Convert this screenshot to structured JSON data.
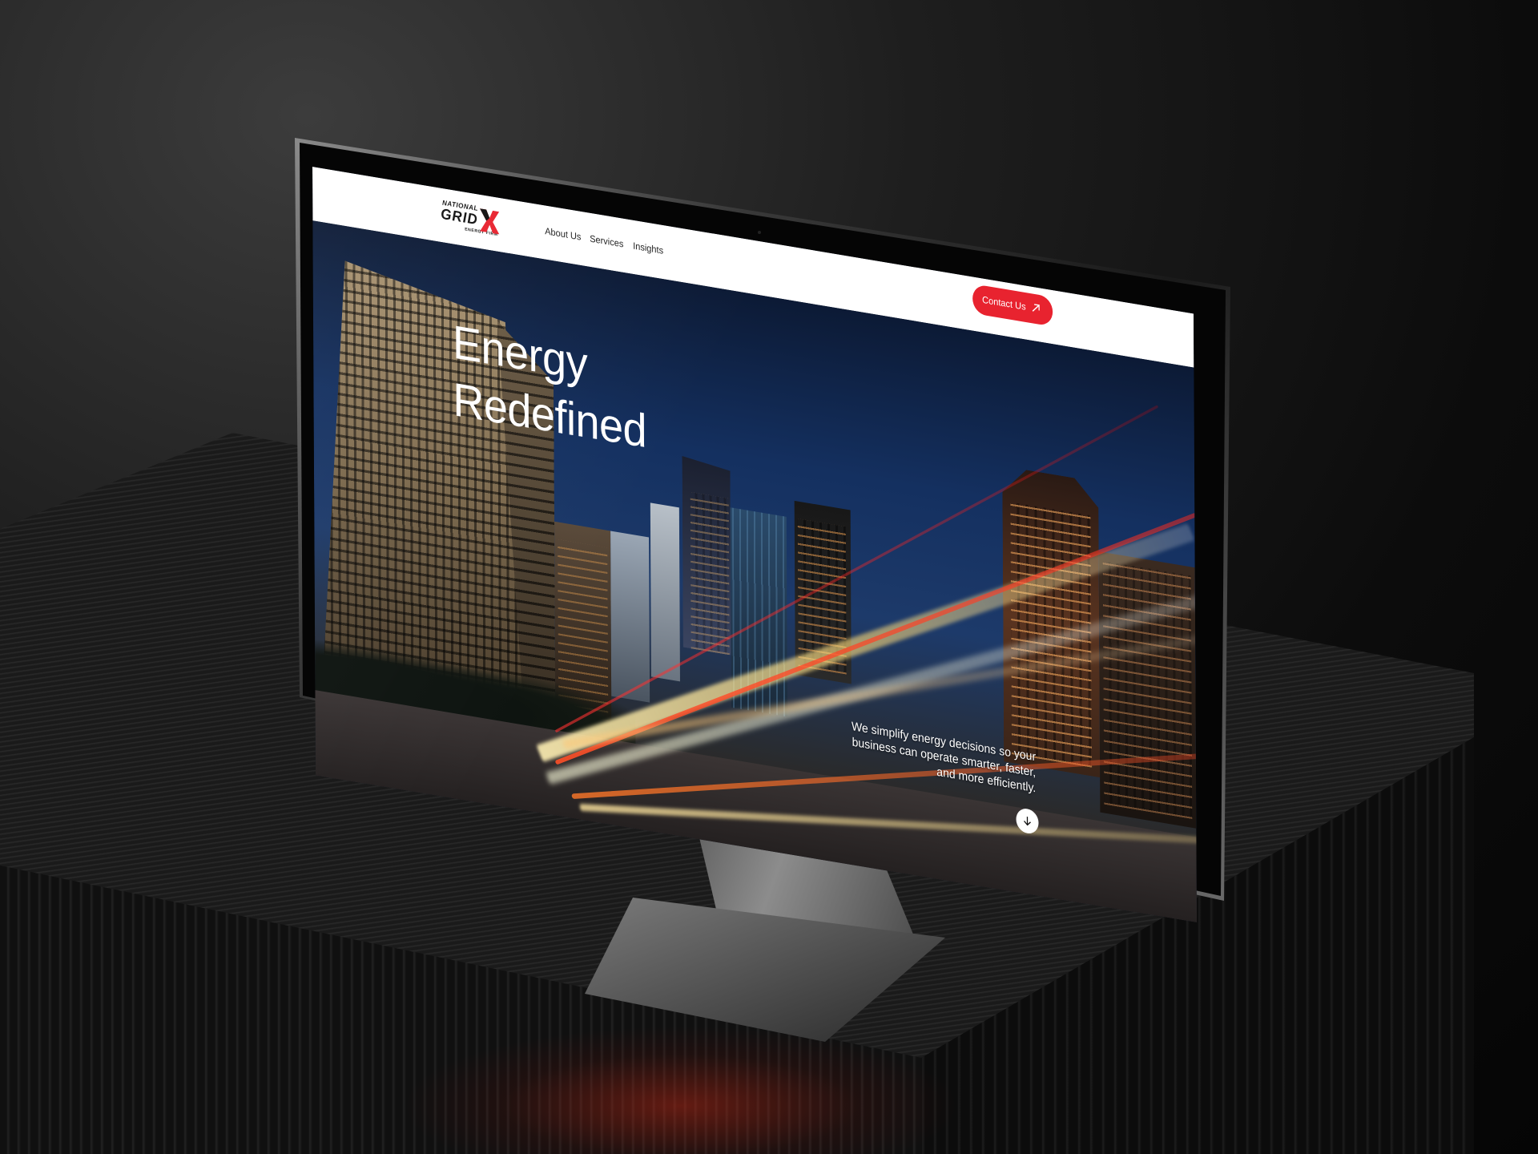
{
  "site": {
    "logo": {
      "line1": "NATIONAL",
      "line2": "GRID",
      "line3": "ENERGY FIRM",
      "mark_icon": "x-mark-icon",
      "brand_color": "#e8232f"
    },
    "nav": {
      "about": "About Us",
      "services": "Services",
      "insights": "Insights"
    },
    "contact_button": {
      "label": "Contact Us",
      "icon": "arrow-up-right-icon",
      "color": "#e8232f"
    },
    "hero": {
      "title_line1": "Energy",
      "title_line2": "Redefined",
      "tagline": "We simplify energy decisions so your business can operate smarter, faster, and more efficiently.",
      "scroll_icon": "arrow-down-icon"
    }
  }
}
